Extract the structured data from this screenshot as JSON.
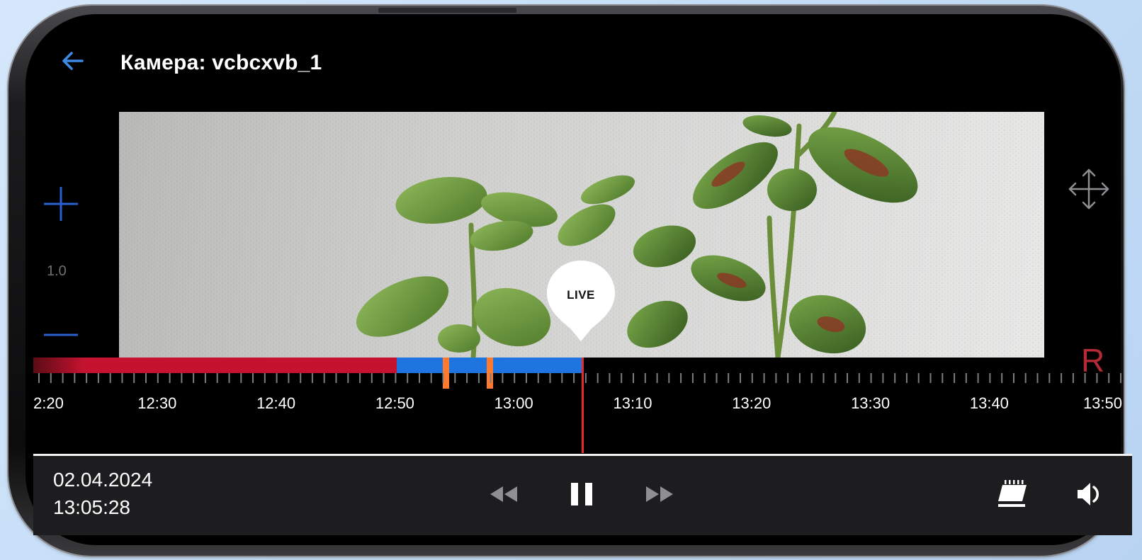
{
  "header": {
    "title": "Камера: vcbcxvb_1"
  },
  "zoom": {
    "level": "1.0"
  },
  "live_marker": {
    "label": "LIVE"
  },
  "recording_indicator": {
    "label": "R"
  },
  "timeline": {
    "tick_labels": [
      "2:20",
      "12:30",
      "12:40",
      "12:50",
      "13:00",
      "13:10",
      "13:20",
      "13:30",
      "13:40",
      "13:50"
    ],
    "colors": {
      "recorded": "#c4122f",
      "recorded_dim": "#5a0c15",
      "live_buffer": "#1f75e0",
      "event": "#ff7a2e",
      "playhead": "#e52b2b"
    }
  },
  "playback": {
    "date": "02.04.2024",
    "time": "13:05:28"
  },
  "icons": {
    "back": "arrow-left-icon",
    "zoom_in": "plus-icon",
    "zoom_out": "minus-icon",
    "pan": "move-arrows-icon",
    "rewind": "rewind-icon",
    "pause": "pause-icon",
    "fast_forward": "fast-forward-icon",
    "calendar": "calendar-icon",
    "volume": "volume-icon"
  }
}
